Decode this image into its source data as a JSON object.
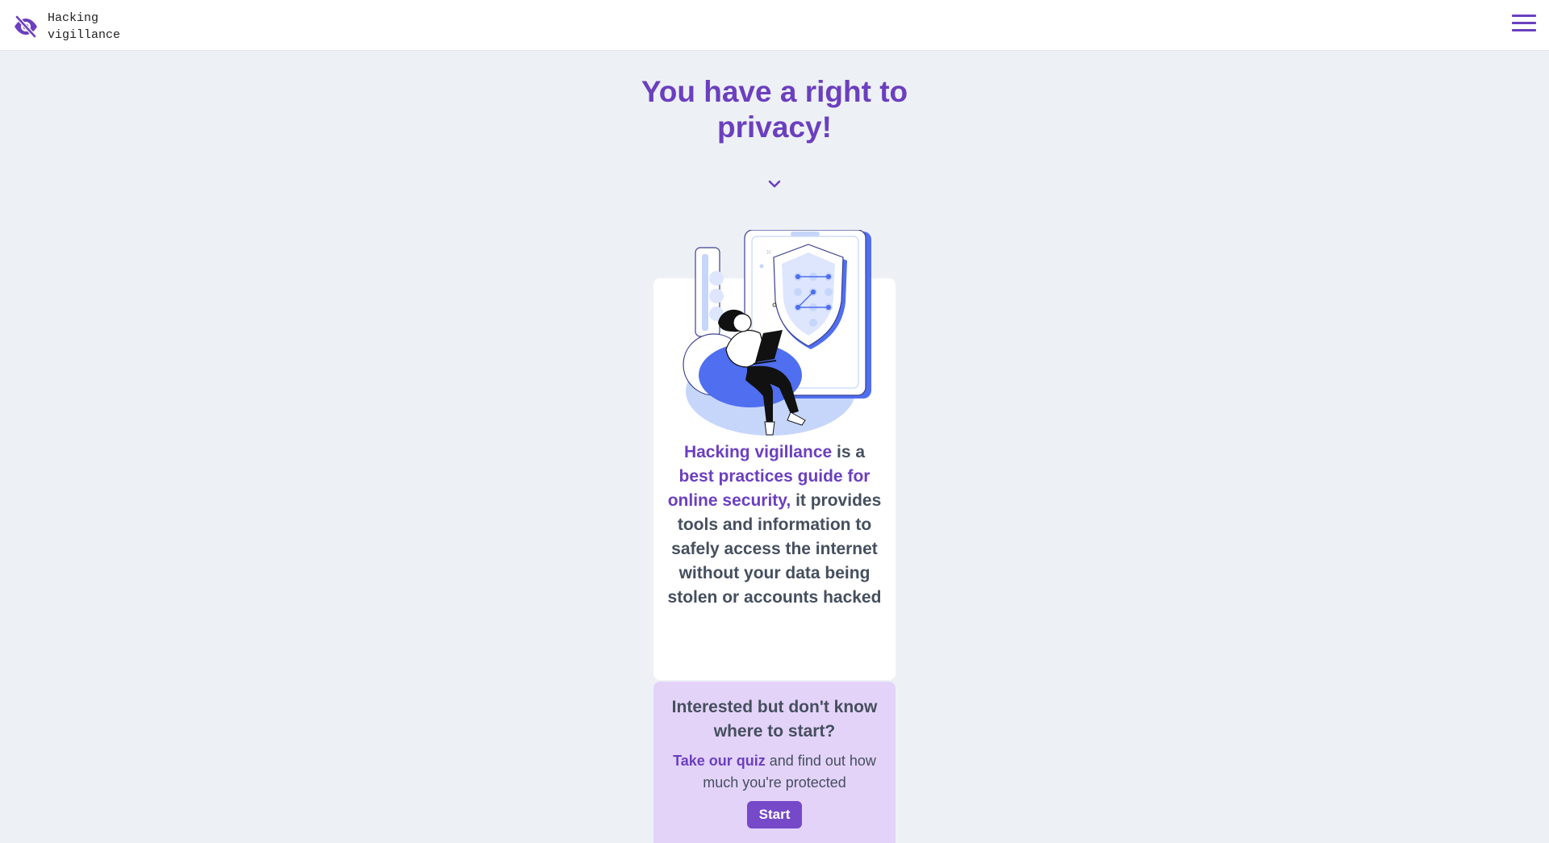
{
  "header": {
    "logo_line1": "Hacking",
    "logo_line2": "vigillance",
    "logo_icon": "eye-slash-icon",
    "menu_icon": "hamburger-menu-icon"
  },
  "hero": {
    "title": "You have a right to privacy!",
    "scroll_icon": "chevron-down-icon"
  },
  "intro": {
    "brand": "Hacking vigillance",
    "text_1": " is a ",
    "highlight": "best practices guide for online security,",
    "text_2": " it provides tools and information to safely access the internet without your data being stolen or accounts hacked"
  },
  "quiz": {
    "title": "Interested but don't know where to start?",
    "link": "Take our quiz",
    "text": " and find out how much you're protected",
    "button": "Start"
  },
  "colors": {
    "accent": "#6b3fbf",
    "background": "#edf1f5",
    "quiz_background": "#e4d3f9",
    "illustration_blue": "#4f6ef0"
  }
}
